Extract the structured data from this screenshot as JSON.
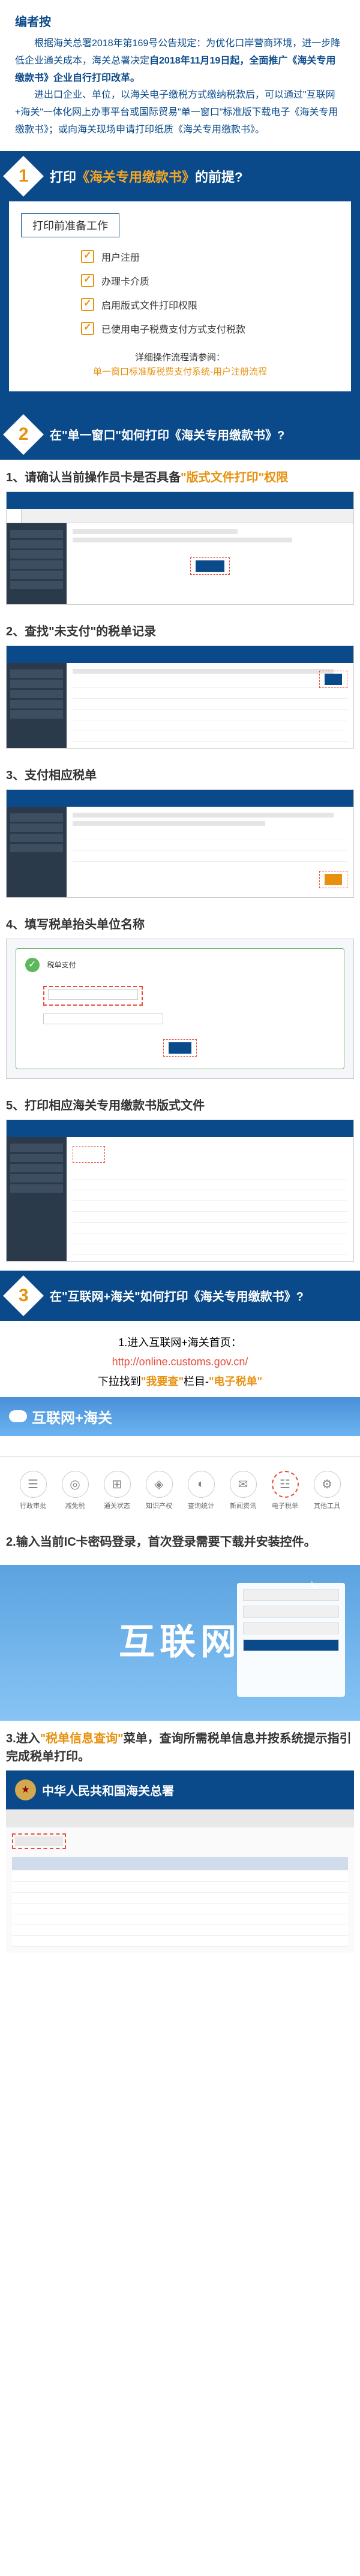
{
  "editor_note": {
    "title": "编者按",
    "body_prefix": "根据海关总署2018年第169号公告规定：为优化口岸营商环境，进一步降低企业通关成本，海关总署决定",
    "body_highlight": "自2018年11月19日起，全面推广《海关专用缴款书》企业自行打印改革。",
    "body_para2": "进出口企业、单位，以海关电子缴税方式缴纳税款后，可以通过\"互联网+海关\"一体化网上办事平台或国际贸易\"单一窗口\"标准版下载电子《海关专用缴款书》；或向海关现场申请打印纸质《海关专用缴款书》。"
  },
  "section1": {
    "number": "1",
    "title_prefix": "打印",
    "title_doc": "《海关专用缴款书》",
    "title_suffix": "的前提?",
    "prep_title": "打印前准备工作",
    "items": [
      "用户注册",
      "办理卡介质",
      "启用版式文件打印权限",
      "已使用电子税费支付方式支付税款"
    ],
    "footer_line1": "详细操作流程请参阅：",
    "footer_line2": "单一窗口标准版税费支付系统-用户注册流程"
  },
  "section2": {
    "number": "2",
    "title": "在\"单一窗口\"如何打印《海关专用缴款书》?",
    "steps": [
      {
        "num": "1、",
        "text_before": "请确认当前操作员卡是否具备",
        "text_orange": "\"版式文件打印\"权限"
      },
      {
        "num": "2、",
        "text": "查找\"未支付\"的税单记录"
      },
      {
        "num": "3、",
        "text": "支付相应税单"
      },
      {
        "num": "4、",
        "text": "填写税单抬头单位名称"
      },
      {
        "num": "5、",
        "text": "打印相应海关专用缴款书版式文件"
      }
    ],
    "green_panel_title": "税单支付"
  },
  "section3": {
    "number": "3",
    "title": "在\"互联网+海关\"如何打印《海关专用缴款书》?",
    "intro_line1": "1.进入互联网+海关首页：",
    "intro_url": "http://online.customs.gov.cn/",
    "intro_line2_before": "下拉找到",
    "intro_line2_orange1": "\"我要查\"",
    "intro_line2_mid": "栏目-",
    "intro_line2_orange2": "\"电子税单\"",
    "portal_name": "互联网+海关",
    "services": [
      "行政审批",
      "减免税",
      "通关状态",
      "知识产权",
      "查询统计",
      "新闻资讯",
      "电子税单",
      "其他工具"
    ],
    "step2_num": "2.",
    "step2_text": "输入当前IC卡密码登录，首次登录需要下载并安装控件。",
    "login_big": "互联网",
    "step3_num": "3.",
    "step3_before": "进入",
    "step3_orange": "\"税单信息查询\"",
    "step3_after": "菜单，查询所需税单信息并按系统提示指引完成税单打印。",
    "gov_title": "中华人民共和国海关总署"
  }
}
